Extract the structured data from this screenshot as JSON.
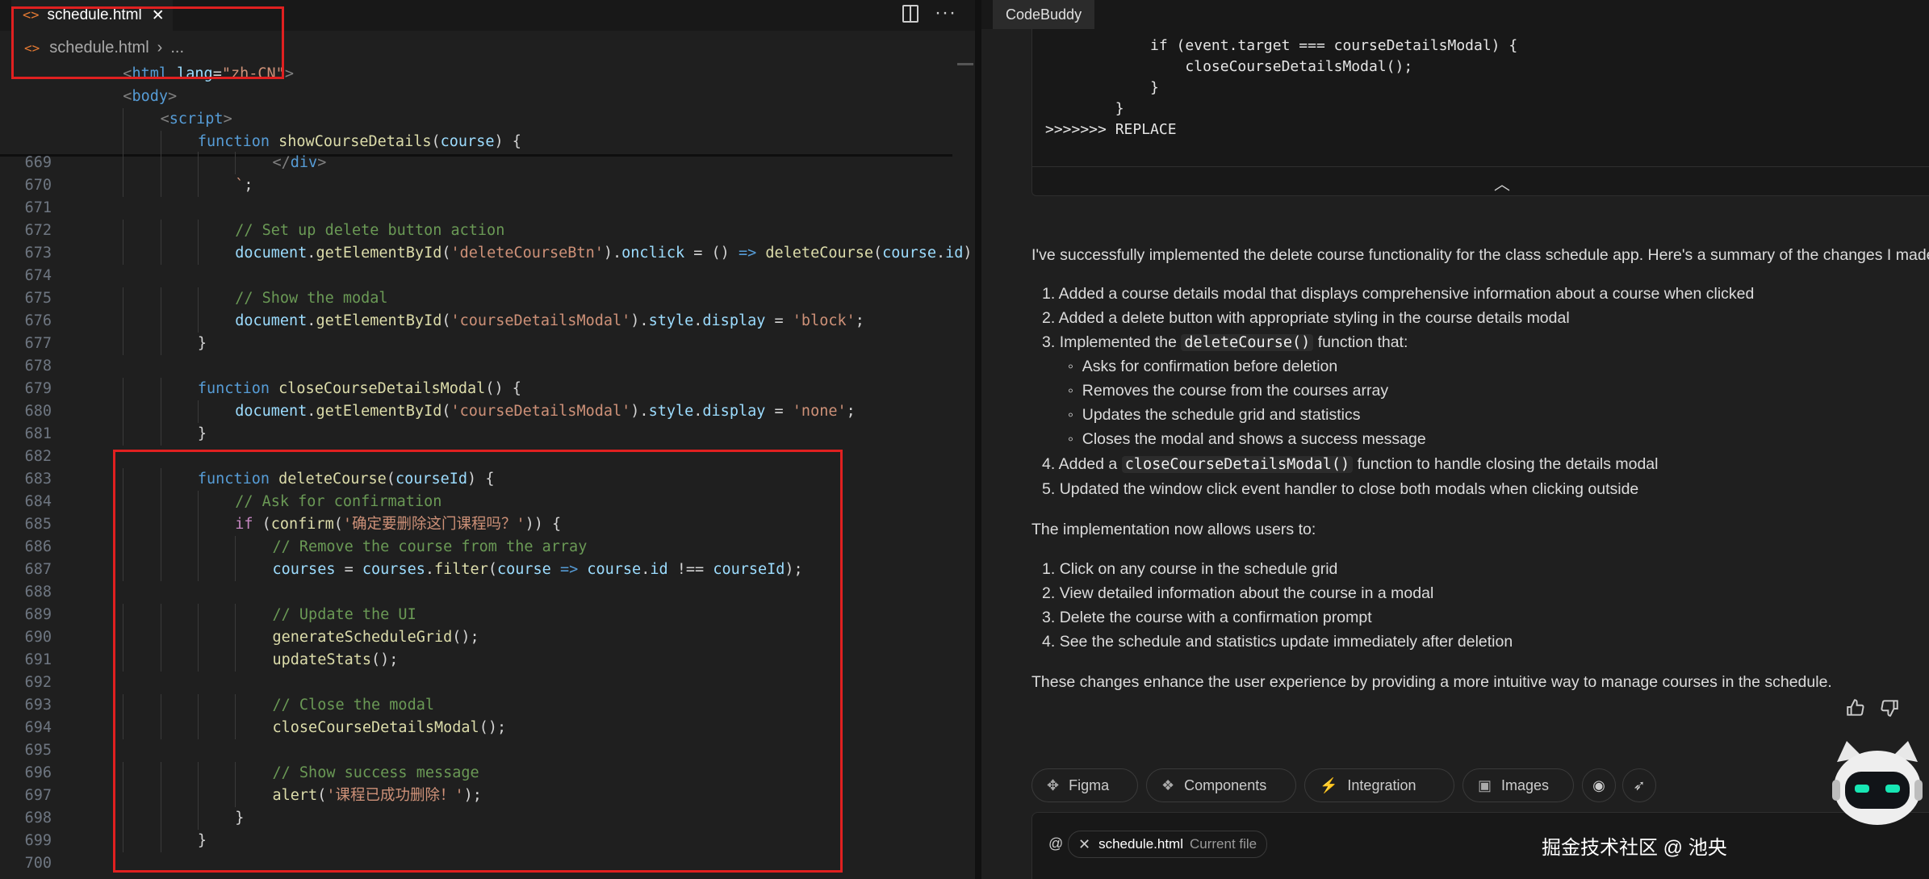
{
  "editor": {
    "tab_label": "schedule.html",
    "breadcrumb_file": "schedule.html",
    "breadcrumb_sep": "›",
    "breadcrumb_more": "...",
    "sticky_lines": [
      {
        "indent": 1,
        "tokens": [
          [
            "t-tag",
            "<"
          ],
          [
            "t-tname",
            "html"
          ],
          [
            "t-p",
            " "
          ],
          [
            "t-attr",
            "lang"
          ],
          [
            "t-p",
            "="
          ],
          [
            "t-str",
            "\"zh-CN\""
          ],
          [
            "t-tag",
            ">"
          ]
        ]
      },
      {
        "indent": 1,
        "tokens": [
          [
            "t-tag",
            "<"
          ],
          [
            "t-tname",
            "body"
          ],
          [
            "t-tag",
            ">"
          ]
        ]
      },
      {
        "indent": 2,
        "tokens": [
          [
            "t-tag",
            "<"
          ],
          [
            "t-tname",
            "script"
          ],
          [
            "t-tag",
            ">"
          ]
        ]
      },
      {
        "indent": 3,
        "tokens": [
          [
            "t-kw",
            "function"
          ],
          [
            "t-p",
            " "
          ],
          [
            "t-fn",
            "showCourseDetails"
          ],
          [
            "t-p",
            "("
          ],
          [
            "t-var",
            "course"
          ],
          [
            "t-p",
            ") {"
          ]
        ]
      }
    ],
    "lines": [
      {
        "n": "669",
        "indent": 5,
        "tokens": [
          [
            "t-tag",
            "</"
          ],
          [
            "t-tname",
            "div"
          ],
          [
            "t-tag",
            ">"
          ]
        ]
      },
      {
        "n": "670",
        "indent": 4,
        "tokens": [
          [
            "t-str",
            "`"
          ],
          [
            "t-p",
            ";"
          ]
        ]
      },
      {
        "n": "671",
        "indent": 0,
        "tokens": []
      },
      {
        "n": "672",
        "indent": 4,
        "tokens": [
          [
            "t-cmt",
            "// Set up delete button action"
          ]
        ]
      },
      {
        "n": "673",
        "indent": 4,
        "tokens": [
          [
            "t-var",
            "document"
          ],
          [
            "t-p",
            "."
          ],
          [
            "t-fn",
            "getElementById"
          ],
          [
            "t-p",
            "("
          ],
          [
            "t-str",
            "'deleteCourseBtn'"
          ],
          [
            "t-p",
            ")."
          ],
          [
            "t-prop",
            "onclick"
          ],
          [
            "t-p",
            " = () "
          ],
          [
            "t-arrow",
            "=>"
          ],
          [
            "t-p",
            " "
          ],
          [
            "t-fn",
            "deleteCourse"
          ],
          [
            "t-p",
            "("
          ],
          [
            "t-var",
            "course"
          ],
          [
            "t-p",
            "."
          ],
          [
            "t-prop",
            "id"
          ],
          [
            "t-p",
            ");"
          ]
        ]
      },
      {
        "n": "674",
        "indent": 0,
        "tokens": []
      },
      {
        "n": "675",
        "indent": 4,
        "tokens": [
          [
            "t-cmt",
            "// Show the modal"
          ]
        ]
      },
      {
        "n": "676",
        "indent": 4,
        "tokens": [
          [
            "t-var",
            "document"
          ],
          [
            "t-p",
            "."
          ],
          [
            "t-fn",
            "getElementById"
          ],
          [
            "t-p",
            "("
          ],
          [
            "t-str",
            "'courseDetailsModal'"
          ],
          [
            "t-p",
            ")."
          ],
          [
            "t-prop",
            "style"
          ],
          [
            "t-p",
            "."
          ],
          [
            "t-prop",
            "display"
          ],
          [
            "t-p",
            " = "
          ],
          [
            "t-str",
            "'block'"
          ],
          [
            "t-p",
            ";"
          ]
        ]
      },
      {
        "n": "677",
        "indent": 3,
        "tokens": [
          [
            "t-p",
            "}"
          ]
        ]
      },
      {
        "n": "678",
        "indent": 0,
        "tokens": []
      },
      {
        "n": "679",
        "indent": 3,
        "tokens": [
          [
            "t-kw",
            "function"
          ],
          [
            "t-p",
            " "
          ],
          [
            "t-fn",
            "closeCourseDetailsModal"
          ],
          [
            "t-p",
            "() {"
          ]
        ]
      },
      {
        "n": "680",
        "indent": 4,
        "tokens": [
          [
            "t-var",
            "document"
          ],
          [
            "t-p",
            "."
          ],
          [
            "t-fn",
            "getElementById"
          ],
          [
            "t-p",
            "("
          ],
          [
            "t-str",
            "'courseDetailsModal'"
          ],
          [
            "t-p",
            ")."
          ],
          [
            "t-prop",
            "style"
          ],
          [
            "t-p",
            "."
          ],
          [
            "t-prop",
            "display"
          ],
          [
            "t-p",
            " = "
          ],
          [
            "t-str",
            "'none'"
          ],
          [
            "t-p",
            ";"
          ]
        ]
      },
      {
        "n": "681",
        "indent": 3,
        "tokens": [
          [
            "t-p",
            "}"
          ]
        ]
      },
      {
        "n": "682",
        "indent": 0,
        "tokens": []
      },
      {
        "n": "683",
        "indent": 3,
        "tokens": [
          [
            "t-kw",
            "function"
          ],
          [
            "t-p",
            " "
          ],
          [
            "t-fn",
            "deleteCourse"
          ],
          [
            "t-p",
            "("
          ],
          [
            "t-var",
            "courseId"
          ],
          [
            "t-p",
            ") {"
          ]
        ]
      },
      {
        "n": "684",
        "indent": 4,
        "tokens": [
          [
            "t-cmt",
            "// Ask for confirmation"
          ]
        ]
      },
      {
        "n": "685",
        "indent": 4,
        "tokens": [
          [
            "t-ctrl",
            "if"
          ],
          [
            "t-p",
            " ("
          ],
          [
            "t-fn",
            "confirm"
          ],
          [
            "t-p",
            "("
          ],
          [
            "t-str",
            "'确定要删除这门课程吗？'"
          ],
          [
            "t-p",
            ")) {"
          ]
        ]
      },
      {
        "n": "686",
        "indent": 5,
        "tokens": [
          [
            "t-cmt",
            "// Remove the course from the array"
          ]
        ]
      },
      {
        "n": "687",
        "indent": 5,
        "tokens": [
          [
            "t-var",
            "courses"
          ],
          [
            "t-p",
            " = "
          ],
          [
            "t-var",
            "courses"
          ],
          [
            "t-p",
            "."
          ],
          [
            "t-fn",
            "filter"
          ],
          [
            "t-p",
            "("
          ],
          [
            "t-var",
            "course"
          ],
          [
            "t-p",
            " "
          ],
          [
            "t-arrow",
            "=>"
          ],
          [
            "t-p",
            " "
          ],
          [
            "t-var",
            "course"
          ],
          [
            "t-p",
            "."
          ],
          [
            "t-prop",
            "id"
          ],
          [
            "t-p",
            " !== "
          ],
          [
            "t-var",
            "courseId"
          ],
          [
            "t-p",
            ");"
          ]
        ]
      },
      {
        "n": "688",
        "indent": 0,
        "tokens": []
      },
      {
        "n": "689",
        "indent": 5,
        "tokens": [
          [
            "t-cmt",
            "// Update the UI"
          ]
        ]
      },
      {
        "n": "690",
        "indent": 5,
        "tokens": [
          [
            "t-fn",
            "generateScheduleGrid"
          ],
          [
            "t-p",
            "();"
          ]
        ]
      },
      {
        "n": "691",
        "indent": 5,
        "tokens": [
          [
            "t-fn",
            "updateStats"
          ],
          [
            "t-p",
            "();"
          ]
        ]
      },
      {
        "n": "692",
        "indent": 0,
        "tokens": []
      },
      {
        "n": "693",
        "indent": 5,
        "tokens": [
          [
            "t-cmt",
            "// Close the modal"
          ]
        ]
      },
      {
        "n": "694",
        "indent": 5,
        "tokens": [
          [
            "t-fn",
            "closeCourseDetailsModal"
          ],
          [
            "t-p",
            "();"
          ]
        ]
      },
      {
        "n": "695",
        "indent": 0,
        "tokens": []
      },
      {
        "n": "696",
        "indent": 5,
        "tokens": [
          [
            "t-cmt",
            "// Show success message"
          ]
        ]
      },
      {
        "n": "697",
        "indent": 5,
        "tokens": [
          [
            "t-fn",
            "alert"
          ],
          [
            "t-p",
            "("
          ],
          [
            "t-str",
            "'课程已成功删除！'"
          ],
          [
            "t-p",
            ");"
          ]
        ]
      },
      {
        "n": "698",
        "indent": 4,
        "tokens": [
          [
            "t-p",
            "}"
          ]
        ]
      },
      {
        "n": "699",
        "indent": 3,
        "tokens": [
          [
            "t-p",
            "}"
          ]
        ]
      },
      {
        "n": "700",
        "indent": 0,
        "tokens": []
      }
    ],
    "colors": {
      "highlight_box": "#e02020",
      "html_icon": "#e37933"
    }
  },
  "chat": {
    "tab_label": "CodeBuddy",
    "code_lines": [
      "            if (event.target === courseDetailsModal) {",
      "                closeCourseDetailsModal();",
      "            }",
      "        }",
      ">>>>>>> REPLACE"
    ],
    "intro": "I've successfully implemented the delete course functionality for the class schedule app. Here's a summary of the changes I made:",
    "summary": {
      "item1": "Added a course details modal that displays comprehensive information about a course when clicked",
      "item2": "Added a delete button with appropriate styling in the course details modal",
      "item3_pre": "Implemented the",
      "item3_code": "deleteCourse()",
      "item3_post": "function that:",
      "sub": [
        "Asks for confirmation before deletion",
        "Removes the course from the courses array",
        "Updates the schedule grid and statistics",
        "Closes the modal and shows a success message"
      ],
      "item4_pre": "Added a",
      "item4_code": "closeCourseDetailsModal()",
      "item4_post": "function to handle closing the details modal",
      "item5": "Updated the window click event handler to close both modals when clicking outside"
    },
    "allows_intro": "The implementation now allows users to:",
    "allows": [
      "Click on any course in the schedule grid",
      "View detailed information about the course in a modal",
      "Delete the course with a confirmation prompt",
      "See the schedule and statistics update immediately after deletion"
    ],
    "closing": "These changes enhance the user experience by providing a more intuitive way to manage courses in the schedule.",
    "pills": {
      "figma": "Figma",
      "components": "Components",
      "integration": "Integration",
      "images": "Images"
    },
    "input": {
      "at": "@",
      "file_chip": "schedule.html",
      "file_chip_note": "Current file"
    },
    "watermark": "掘金技术社区 @ 池央"
  }
}
